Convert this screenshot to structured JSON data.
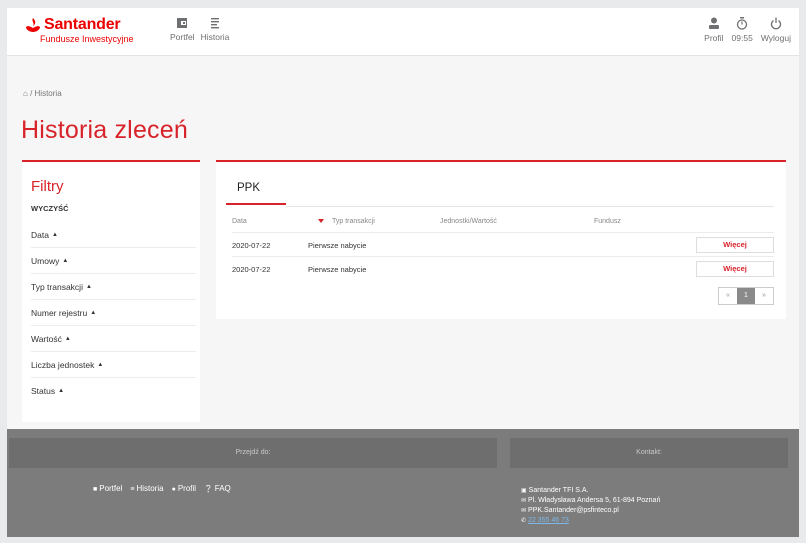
{
  "brand": {
    "name": "Santander",
    "subtitle": "Fundusze Inwestycyjne"
  },
  "nav": [
    {
      "label": "Portfel",
      "icon": "wallet-icon"
    },
    {
      "label": "Historia",
      "icon": "list-icon"
    }
  ],
  "top_right": {
    "profile": "Profil",
    "timer": "09:55",
    "logout": "Wyloguj"
  },
  "breadcrumb": "/ Historia",
  "page_title": "Historia zleceń",
  "filters": {
    "title": "Filtry",
    "clear": "WYCZYŚĆ",
    "items": [
      "Data",
      "Umowy",
      "Typ transakcji",
      "Numer rejestru",
      "Wartość",
      "Liczba jednostek",
      "Status"
    ]
  },
  "tab": "PPK",
  "table": {
    "headers": [
      "Data",
      "Typ transakcji",
      "Jednostki/Wartość",
      "Fundusz"
    ],
    "rows": [
      {
        "date": "2020-07-22",
        "type": "Pierwsze nabycie",
        "units": "",
        "fund": "",
        "action": "Więcej"
      },
      {
        "date": "2020-07-22",
        "type": "Pierwsze nabycie",
        "units": "",
        "fund": "",
        "action": "Więcej"
      }
    ]
  },
  "pager": {
    "prev": "«",
    "page": "1",
    "next": "»"
  },
  "footer": {
    "goto_label": "Przejdź do:",
    "links": [
      "Portfel",
      "Historia",
      "Profil",
      "FAQ"
    ],
    "contact_label": "Kontakt:",
    "company": "Santander TFI S.A.",
    "address": "Pl. Władysława Andersa 5, 61-894 Poznań",
    "email": "PPK.Santander@psfinteco.pl",
    "phone": "22 355 46 73"
  },
  "colors": {
    "brand_red": "#ec0000",
    "accent_red": "#d8232a"
  }
}
